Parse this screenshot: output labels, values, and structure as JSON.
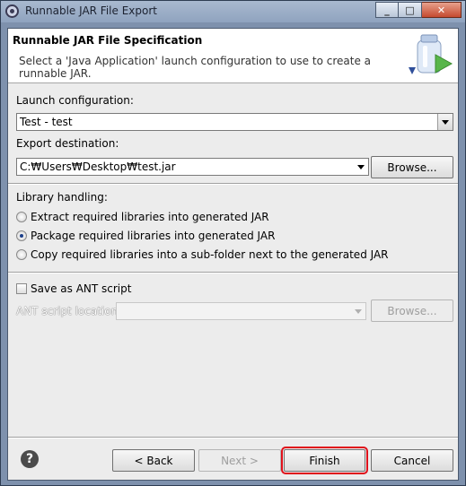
{
  "window": {
    "title": "Runnable JAR File Export",
    "minimize": "_",
    "maximize": "□",
    "close": "✕"
  },
  "header": {
    "title": "Runnable JAR File Specification",
    "description": "Select a 'Java Application' launch configuration to use to create a runnable JAR."
  },
  "launch": {
    "label": "Launch configuration:",
    "value": "Test - test"
  },
  "export": {
    "label": "Export destination:",
    "value": "C:₩Users₩Desktop₩test.jar",
    "browse": "Browse..."
  },
  "library": {
    "label": "Library handling:",
    "options": [
      {
        "label": "Extract required libraries into generated JAR",
        "selected": false
      },
      {
        "label": "Package required libraries into generated JAR",
        "selected": true
      },
      {
        "label": "Copy required libraries into a sub-folder next to the generated JAR",
        "selected": false
      }
    ]
  },
  "ant": {
    "checkbox_label": "Save as ANT script",
    "checked": false,
    "location_label": "ANT script location:",
    "value": "",
    "browse": "Browse..."
  },
  "buttons": {
    "back": "< Back",
    "next": "Next >",
    "finish": "Finish",
    "cancel": "Cancel",
    "help": "?"
  },
  "colors": {
    "highlight": "#e0101a"
  }
}
